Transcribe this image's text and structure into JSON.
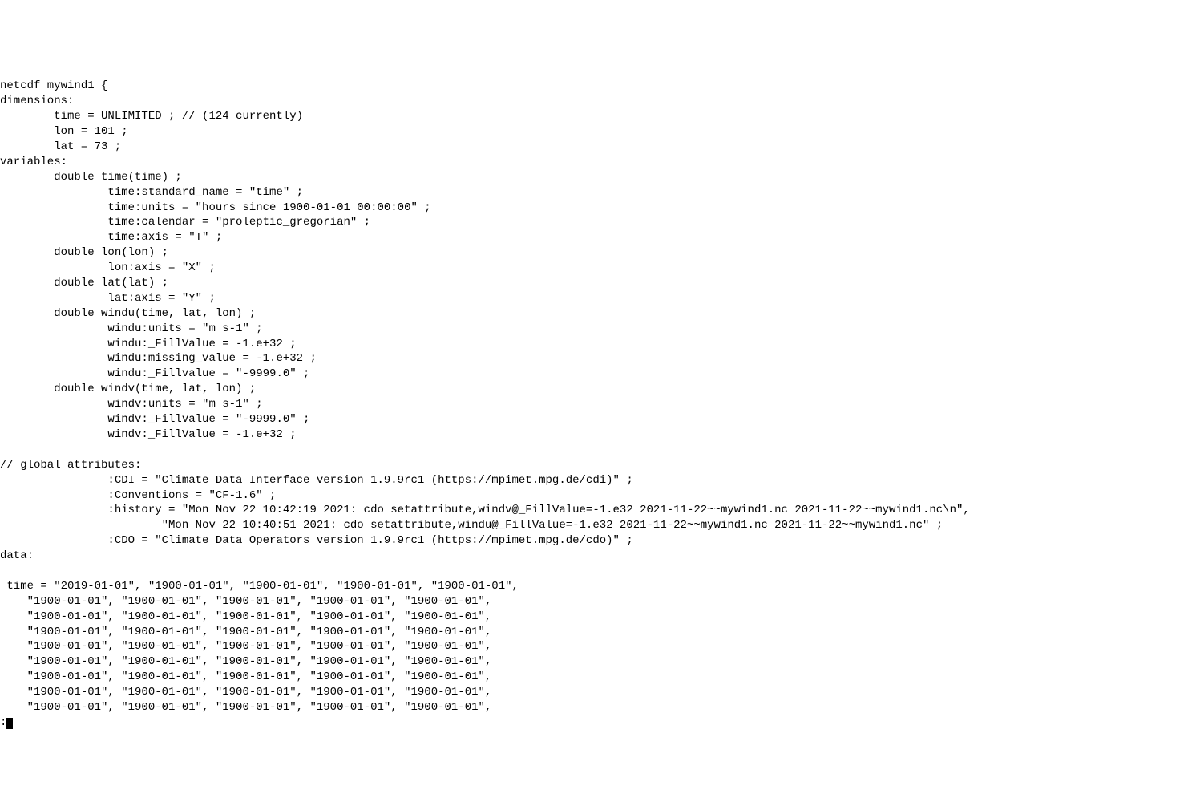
{
  "ncdump": {
    "header": "netcdf mywind1 {",
    "dimensions_label": "dimensions:",
    "dimensions": {
      "time": "        time = UNLIMITED ; // (124 currently)",
      "lon": "        lon = 101 ;",
      "lat": "        lat = 73 ;"
    },
    "variables_label": "variables:",
    "variables": {
      "time_decl": "        double time(time) ;",
      "time_standard_name": "                time:standard_name = \"time\" ;",
      "time_units": "                time:units = \"hours since 1900-01-01 00:00:00\" ;",
      "time_calendar": "                time:calendar = \"proleptic_gregorian\" ;",
      "time_axis": "                time:axis = \"T\" ;",
      "lon_decl": "        double lon(lon) ;",
      "lon_axis": "                lon:axis = \"X\" ;",
      "lat_decl": "        double lat(lat) ;",
      "lat_axis": "                lat:axis = \"Y\" ;",
      "windu_decl": "        double windu(time, lat, lon) ;",
      "windu_units": "                windu:units = \"m s-1\" ;",
      "windu_FillValue": "                windu:_FillValue = -1.e+32 ;",
      "windu_missing_value": "                windu:missing_value = -1.e+32 ;",
      "windu_Fillvalue_lc": "                windu:_Fillvalue = \"-9999.0\" ;",
      "windv_decl": "        double windv(time, lat, lon) ;",
      "windv_units": "                windv:units = \"m s-1\" ;",
      "windv_Fillvalue_lc": "                windv:_Fillvalue = \"-9999.0\" ;",
      "windv_FillValue": "                windv:_FillValue = -1.e+32 ;"
    },
    "blank1": "",
    "globals_label": "// global attributes:",
    "globals": {
      "cdi": "                :CDI = \"Climate Data Interface version 1.9.9rc1 (https://mpimet.mpg.de/cdi)\" ;",
      "conventions": "                :Conventions = \"CF-1.6\" ;",
      "history_l1": "                :history = \"Mon Nov 22 10:42:19 2021: cdo setattribute,windv@_FillValue=-1.e32 2021-11-22~~mywind1.nc 2021-11-22~~mywind1.nc\\n\",",
      "history_l2": "                        \"Mon Nov 22 10:40:51 2021: cdo setattribute,windu@_FillValue=-1.e32 2021-11-22~~mywind1.nc 2021-11-22~~mywind1.nc\" ;",
      "cdo": "                :CDO = \"Climate Data Operators version 1.9.9rc1 (https://mpimet.mpg.de/cdo)\" ;"
    },
    "data_label": "data:",
    "blank2": "",
    "time_data": {
      "l1": " time = \"2019-01-01\", \"1900-01-01\", \"1900-01-01\", \"1900-01-01\", \"1900-01-01\",",
      "l2": "    \"1900-01-01\", \"1900-01-01\", \"1900-01-01\", \"1900-01-01\", \"1900-01-01\",",
      "l3": "    \"1900-01-01\", \"1900-01-01\", \"1900-01-01\", \"1900-01-01\", \"1900-01-01\",",
      "l4": "    \"1900-01-01\", \"1900-01-01\", \"1900-01-01\", \"1900-01-01\", \"1900-01-01\",",
      "l5": "    \"1900-01-01\", \"1900-01-01\", \"1900-01-01\", \"1900-01-01\", \"1900-01-01\",",
      "l6": "    \"1900-01-01\", \"1900-01-01\", \"1900-01-01\", \"1900-01-01\", \"1900-01-01\",",
      "l7": "    \"1900-01-01\", \"1900-01-01\", \"1900-01-01\", \"1900-01-01\", \"1900-01-01\",",
      "l8": "    \"1900-01-01\", \"1900-01-01\", \"1900-01-01\", \"1900-01-01\", \"1900-01-01\",",
      "l9": "    \"1900-01-01\", \"1900-01-01\", \"1900-01-01\", \"1900-01-01\", \"1900-01-01\","
    },
    "pager_prompt": ":"
  }
}
